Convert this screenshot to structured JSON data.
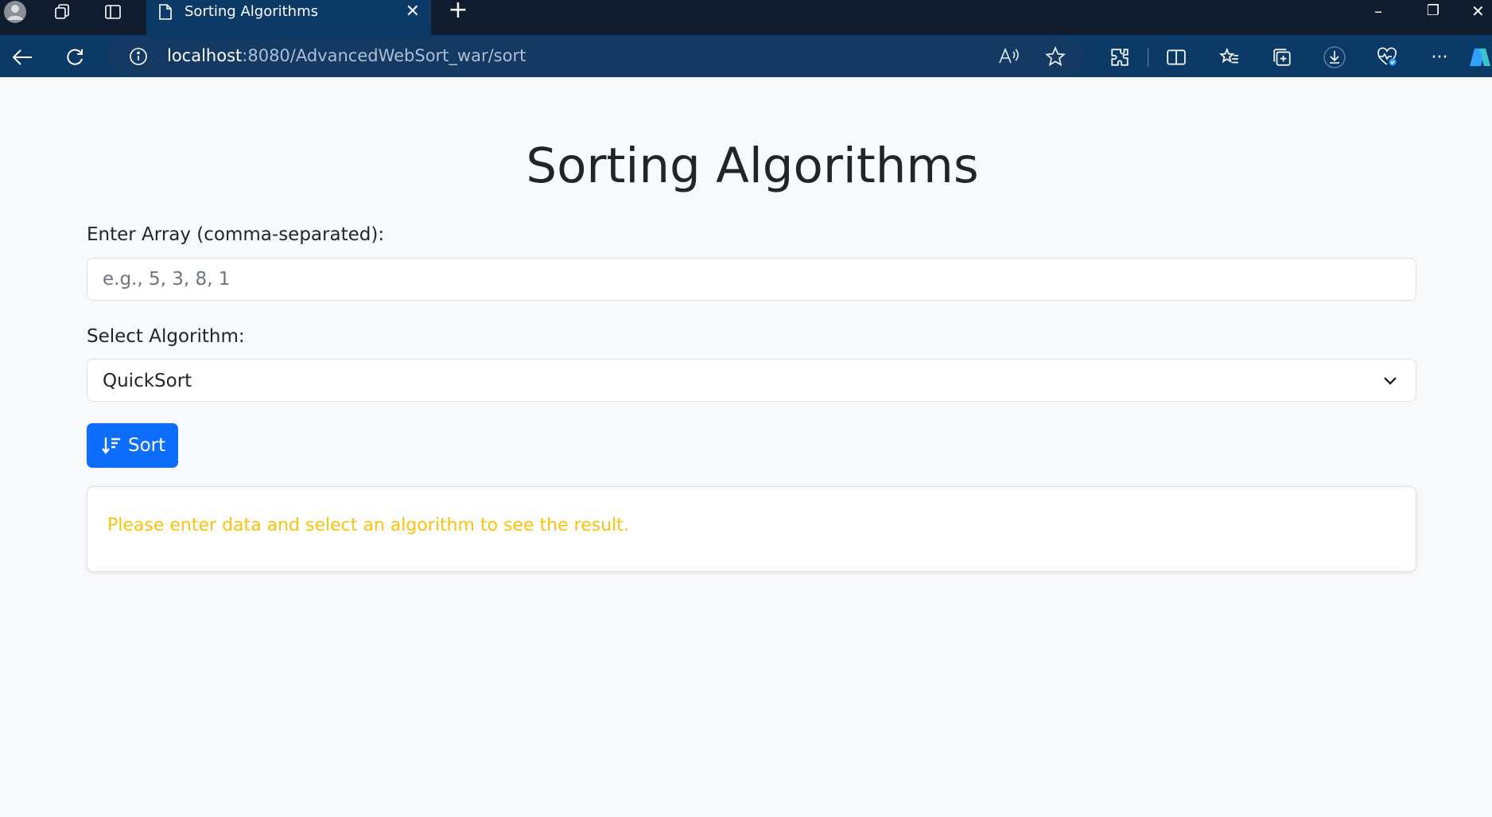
{
  "browser": {
    "tab_title": "Sorting Algorithms",
    "url_host": "localhost",
    "url_path": ":8080/AdvancedWebSort_war/sort"
  },
  "page": {
    "title": "Sorting Algorithms",
    "array_label": "Enter Array (comma-separated):",
    "array_placeholder": "e.g., 5, 3, 8, 1",
    "array_value": "",
    "algorithm_label": "Select Algorithm:",
    "algorithm_selected": "QuickSort",
    "sort_button": "Sort",
    "result_message": "Please enter data and select an algorithm to see the result."
  },
  "colors": {
    "primary": "#0d6efd",
    "warning": "#ffc107",
    "titlebar": "#0f1c2e",
    "toolbar": "#0b3a66"
  },
  "icons": {
    "profile": "profile-icon",
    "workspaces": "workspaces-icon",
    "tab_actions": "tab-actions-icon",
    "page": "page-icon",
    "sort": "sort-down-icon"
  }
}
